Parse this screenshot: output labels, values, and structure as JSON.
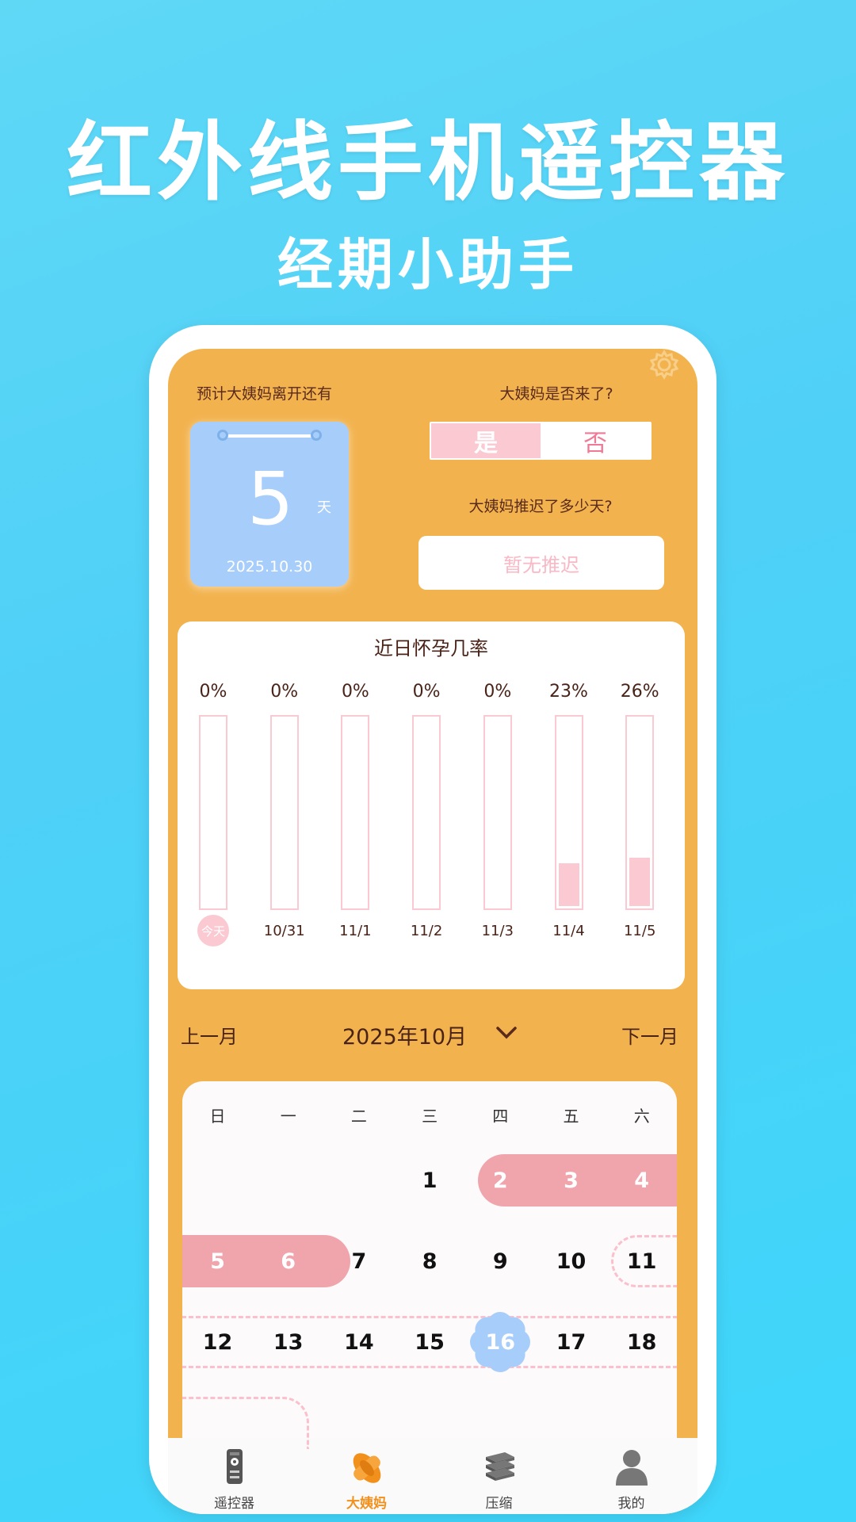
{
  "promo": {
    "title": "红外线手机遥控器",
    "subtitle": "经期小助手"
  },
  "header": {
    "countdown_label": "预计大姨妈离开还有",
    "days_value": "5",
    "days_unit": "天",
    "end_date": "2025.10.30",
    "came_question": "大姨妈是否来了?",
    "came_yes": "是",
    "came_no": "否",
    "came_selected": "是",
    "delay_question": "大姨妈推迟了多少天?",
    "delay_value": "暂无推迟"
  },
  "probability": {
    "title": "近日怀孕几率",
    "days": [
      {
        "pct": "0%",
        "value": 0,
        "date": "今天",
        "is_today": true
      },
      {
        "pct": "0%",
        "value": 0,
        "date": "10/31",
        "is_today": false
      },
      {
        "pct": "0%",
        "value": 0,
        "date": "11/1",
        "is_today": false
      },
      {
        "pct": "0%",
        "value": 0,
        "date": "11/2",
        "is_today": false
      },
      {
        "pct": "0%",
        "value": 0,
        "date": "11/3",
        "is_today": false
      },
      {
        "pct": "23%",
        "value": 23,
        "date": "11/4",
        "is_today": false
      },
      {
        "pct": "26%",
        "value": 26,
        "date": "11/5",
        "is_today": false
      }
    ]
  },
  "calendar": {
    "prev_label": "上一月",
    "next_label": "下一月",
    "current_month": "2025年10月",
    "weekdays": [
      "日",
      "一",
      "二",
      "三",
      "四",
      "五",
      "六"
    ],
    "rows": [
      [
        "",
        "",
        "",
        "1",
        "2",
        "3",
        "4"
      ],
      [
        "5",
        "6",
        "7",
        "8",
        "9",
        "10",
        "11"
      ],
      [
        "12",
        "13",
        "14",
        "15",
        "16",
        "17",
        "18"
      ]
    ],
    "period_days": [
      "2",
      "3",
      "4",
      "5",
      "6"
    ],
    "fertile_days": [
      "11",
      "12",
      "13",
      "14",
      "15",
      "16",
      "17",
      "18"
    ],
    "ovulation_day": "16",
    "colors": {
      "period": "#f0a5ad",
      "fertile": "#fbc0cb",
      "ovulation": "#a7cdfb"
    }
  },
  "tabs": [
    {
      "label": "遥控器",
      "icon": "remote-icon",
      "active": false
    },
    {
      "label": "大姨妈",
      "icon": "pad-icon",
      "active": true
    },
    {
      "label": "压缩",
      "icon": "compress-icon",
      "active": false
    },
    {
      "label": "我的",
      "icon": "user-icon",
      "active": false
    }
  ]
}
